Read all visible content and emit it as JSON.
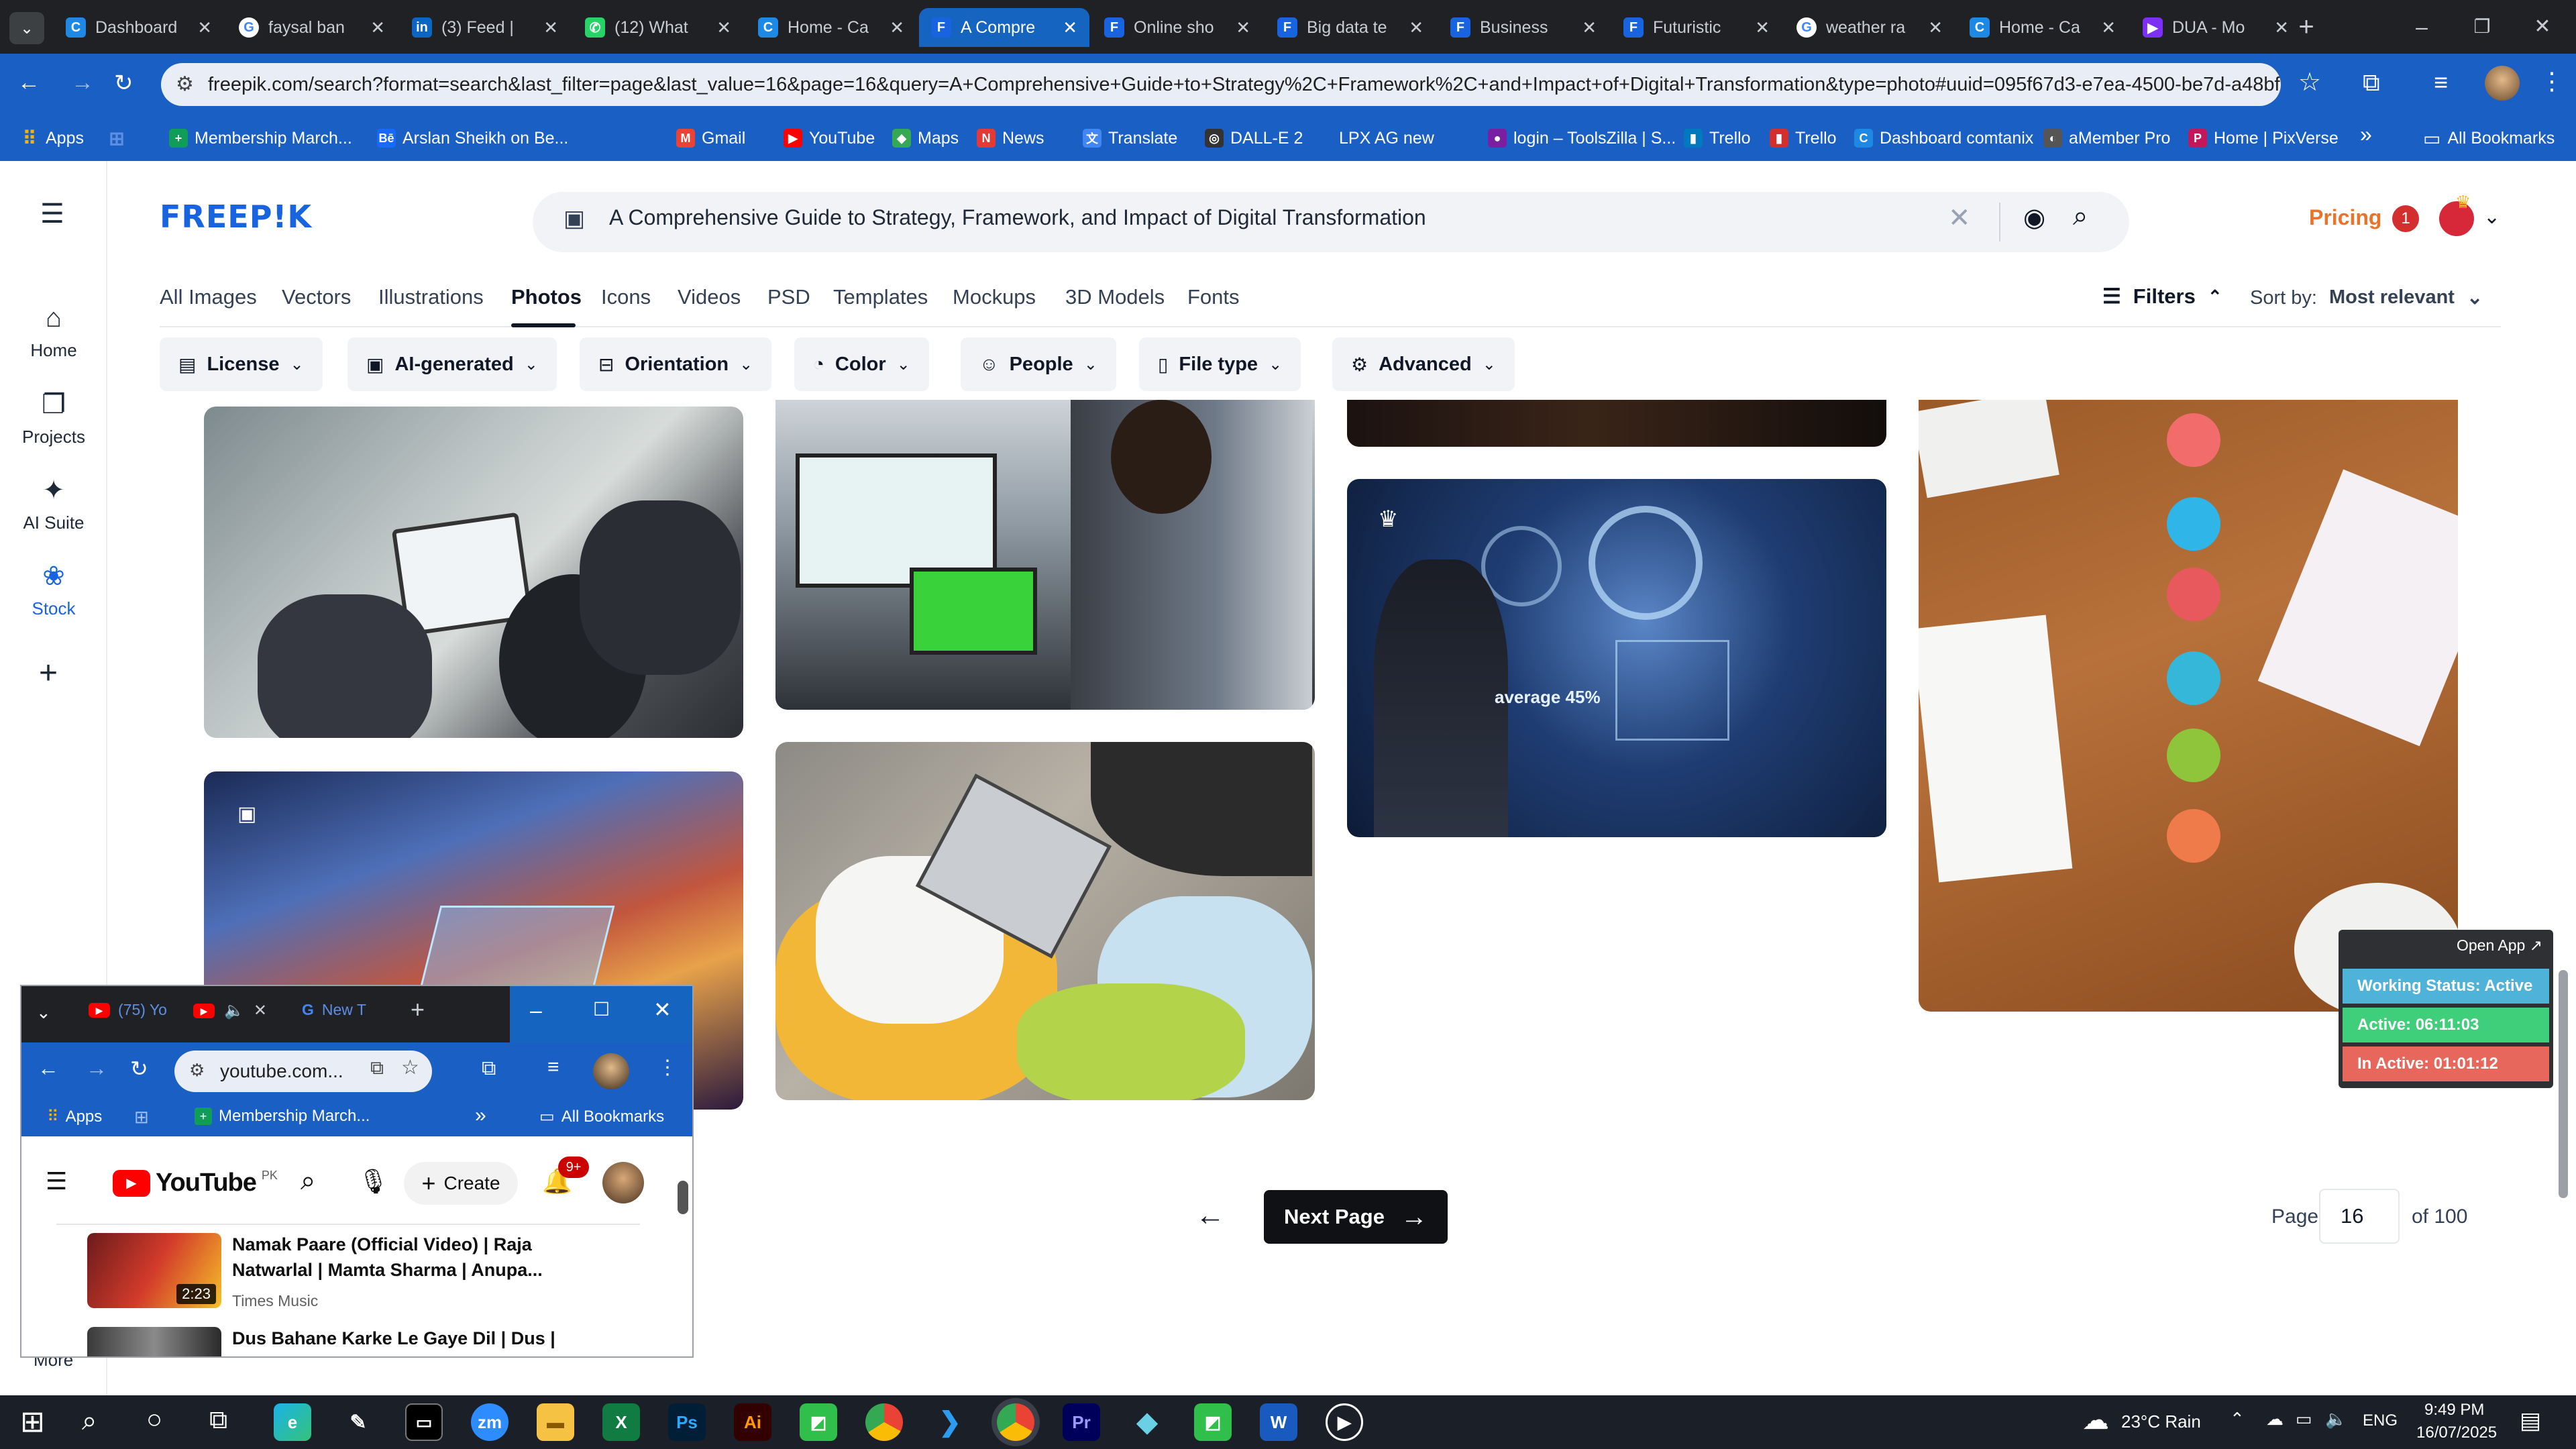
{
  "browser": {
    "tabs": [
      {
        "title": "Dashboard",
        "color": "#1e88e5",
        "glyph": "C"
      },
      {
        "title": "faysal ban",
        "color": "#ffffff",
        "glyph": "G"
      },
      {
        "title": "(3) Feed |",
        "color": "#0a66c2",
        "glyph": "in"
      },
      {
        "title": "(12) What",
        "color": "#25d366",
        "glyph": "✆"
      },
      {
        "title": "Home - Ca",
        "color": "#1e88e5",
        "glyph": "C"
      },
      {
        "title": "A Compre",
        "color": "#1763e0",
        "glyph": "F"
      },
      {
        "title": "Online sho",
        "color": "#1763e0",
        "glyph": "F"
      },
      {
        "title": "Big data te",
        "color": "#1763e0",
        "glyph": "F"
      },
      {
        "title": "Business",
        "color": "#1763e0",
        "glyph": "F"
      },
      {
        "title": "Futuristic",
        "color": "#1763e0",
        "glyph": "F"
      },
      {
        "title": "weather ra",
        "color": "#ffffff",
        "glyph": "G"
      },
      {
        "title": "Home - Ca",
        "color": "#1e88e5",
        "glyph": "C"
      },
      {
        "title": "DUA - Mo",
        "color": "#7b2ff7",
        "glyph": "▶"
      }
    ],
    "url": "freepik.com/search?format=search&last_filter=page&last_value=16&page=16&query=A+Comprehensive+Guide+to+Strategy%2C+Framework%2C+and+Impact+of+Digital+Transformation&type=photo#uuid=095f67d3-e7ea-4500-be7d-a48bfbc8...",
    "bookmarks": [
      {
        "label": "Apps",
        "color": "#f4b400",
        "glyph": "⠿"
      },
      {
        "label": "",
        "color": "#5f8fe0",
        "glyph": "⊞"
      },
      {
        "label": "Membership March...",
        "color": "#0f9d58",
        "glyph": "+"
      },
      {
        "label": "Arslan Sheikh on Be...",
        "color": "#1769ff",
        "glyph": "Bē"
      },
      {
        "label": "Gmail",
        "color": "#ea4335",
        "glyph": "M"
      },
      {
        "label": "YouTube",
        "color": "#ff0000",
        "glyph": "▶"
      },
      {
        "label": "Maps",
        "color": "#34a853",
        "glyph": "◆"
      },
      {
        "label": "News",
        "color": "#e53935",
        "glyph": "N"
      },
      {
        "label": "Translate",
        "color": "#4285f4",
        "glyph": "文"
      },
      {
        "label": "DALL-E 2",
        "color": "#333333",
        "glyph": "◎"
      },
      {
        "label": "LPX AG new",
        "color": "#1a5fc4",
        "glyph": ""
      },
      {
        "label": "login – ToolsZilla | S...",
        "color": "#7b1fa2",
        "glyph": "●"
      },
      {
        "label": "Trello",
        "color": "#0079bf",
        "glyph": "▮"
      },
      {
        "label": "Trello",
        "color": "#d32f2f",
        "glyph": "▮"
      },
      {
        "label": "Dashboard comtanix",
        "color": "#1e88e5",
        "glyph": "C"
      },
      {
        "label": "aMember Pro",
        "color": "#555555",
        "glyph": "◐"
      },
      {
        "label": "Home | PixVerse",
        "color": "#c2185b",
        "glyph": "P"
      }
    ],
    "all_bookmarks": "All Bookmarks"
  },
  "freepik": {
    "logo": "FREEP!K",
    "rail": [
      {
        "label": "Home",
        "icon": "home-icon"
      },
      {
        "label": "Projects",
        "icon": "projects-icon"
      },
      {
        "label": "AI Suite",
        "icon": "sparkle-icon"
      },
      {
        "label": "Stock",
        "icon": "stock-icon"
      }
    ],
    "more_label": "More",
    "search_text": "A Comprehensive Guide to Strategy, Framework, and Impact of Digital Transformation",
    "pricing": "Pricing",
    "notif_count": "1",
    "categories": [
      "All Images",
      "Vectors",
      "Illustrations",
      "Photos",
      "Icons",
      "Videos",
      "PSD",
      "Templates",
      "Mockups",
      "3D Models",
      "Fonts"
    ],
    "selected_category": "Photos",
    "filters_label": "Filters",
    "sort_label": "Sort by:",
    "sort_value": "Most relevant",
    "filter_chips": [
      {
        "label": "License",
        "icon": "license-icon"
      },
      {
        "label": "AI-generated",
        "icon": "ai-icon"
      },
      {
        "label": "Orientation",
        "icon": "orientation-icon"
      },
      {
        "label": "Color",
        "icon": "palette-icon"
      },
      {
        "label": "People",
        "icon": "people-icon"
      },
      {
        "label": "File type",
        "icon": "file-icon"
      },
      {
        "label": "Advanced",
        "icon": "gear-icon"
      }
    ],
    "pagination": {
      "next_label": "Next Page",
      "page_label": "Page",
      "page_value": "16",
      "of_label": "of 100"
    }
  },
  "work_widget": {
    "open_app": "Open App ↗",
    "status": "Working Status: Active",
    "active": "Active: 06:11:03",
    "inactive": "In Active: 01:01:12",
    "colors": {
      "status": "#4fb3d9",
      "active": "#3fcf7a",
      "inactive": "#e8675c"
    }
  },
  "youtube_window": {
    "tabs": [
      "(75) Yo",
      "",
      "New T"
    ],
    "url": "youtube.com...",
    "bookmarks": [
      "Apps",
      "Membership March...",
      "All Bookmarks"
    ],
    "brand": "YouTube",
    "region": "PK",
    "create_label": "Create",
    "notif_badge": "9+",
    "videos": [
      {
        "title_line1": "Namak Paare (Official Video) | Raja",
        "title_line2": "Natwarlal | Mamta Sharma | Anupa...",
        "channel": "Times Music",
        "duration": "2:23"
      },
      {
        "title_line1": "Dus Bahane Karke Le Gaye Dil | Dus |",
        "title_line2": "",
        "channel": "",
        "duration": ""
      }
    ]
  },
  "taskbar": {
    "weather": "23°C  Rain",
    "lang": "ENG",
    "time": "9:49 PM",
    "date": "16/07/2025"
  }
}
